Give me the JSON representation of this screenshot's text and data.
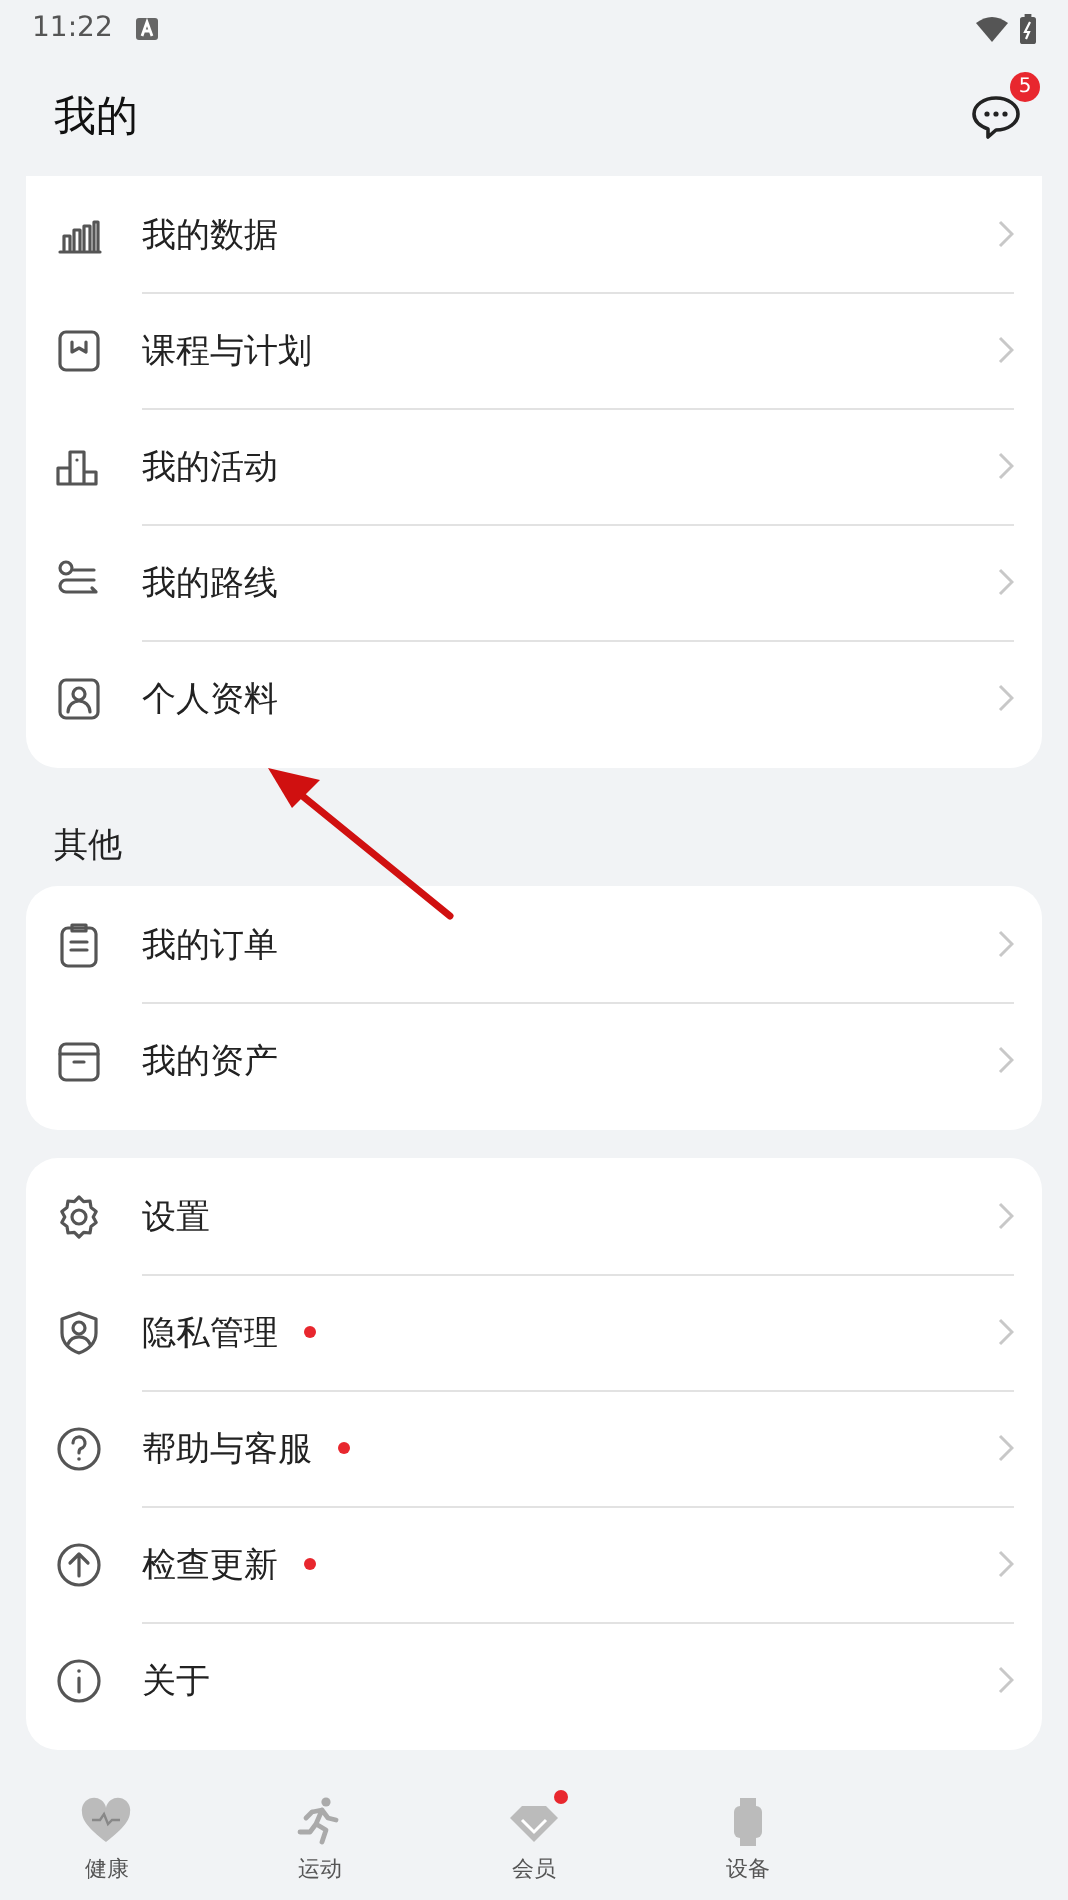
{
  "status_bar": {
    "time": "11:22"
  },
  "header": {
    "title": "我的",
    "message_badge": "5"
  },
  "sections": [
    {
      "items": [
        {
          "label": "我的数据",
          "dot": false
        },
        {
          "label": "课程与计划",
          "dot": false
        },
        {
          "label": "我的活动",
          "dot": false
        },
        {
          "label": "我的路线",
          "dot": false
        },
        {
          "label": "个人资料",
          "dot": false
        }
      ]
    },
    {
      "title": "其他",
      "items": [
        {
          "label": "我的订单",
          "dot": false
        },
        {
          "label": "我的资产",
          "dot": false
        }
      ]
    },
    {
      "items": [
        {
          "label": "设置",
          "dot": false
        },
        {
          "label": "隐私管理",
          "dot": true
        },
        {
          "label": "帮助与客服",
          "dot": true
        },
        {
          "label": "检查更新",
          "dot": true
        },
        {
          "label": "关于",
          "dot": false
        }
      ]
    }
  ],
  "bottom_nav": [
    {
      "label": "健康",
      "dot": false
    },
    {
      "label": "运动",
      "dot": false
    },
    {
      "label": "会员",
      "dot": true
    },
    {
      "label": "设备",
      "dot": false
    }
  ]
}
